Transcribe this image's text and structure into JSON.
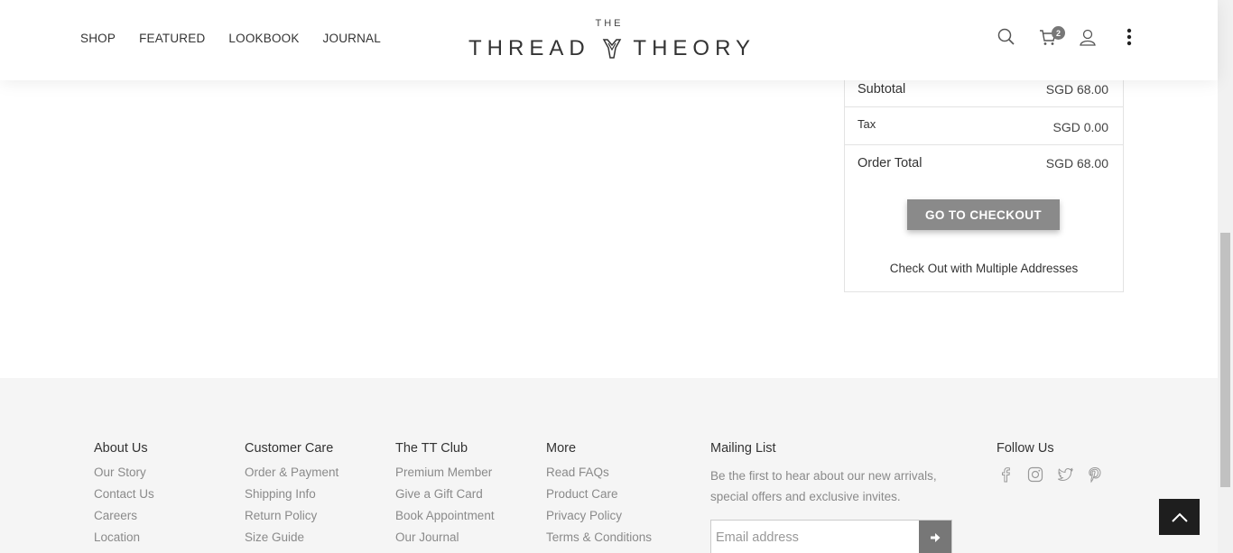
{
  "nav": {
    "items": [
      "SHOP",
      "FEATURED",
      "LOOKBOOK",
      "JOURNAL"
    ]
  },
  "logo": {
    "top": "THE",
    "left": "THREAD",
    "right": "THEORY"
  },
  "header": {
    "cart_count": "2",
    "icons": [
      "search-icon",
      "cart-icon",
      "user-icon",
      "more-vertical-icon"
    ]
  },
  "summary": {
    "subtotal_label": "Subtotal",
    "subtotal_value": "SGD 68.00",
    "tax_label": "Tax",
    "tax_value": "SGD 0.00",
    "total_label": "Order Total",
    "total_value": "SGD 68.00",
    "checkout_label": "GO TO CHECKOUT",
    "multi_label": "Check Out with Multiple Addresses"
  },
  "footer": {
    "about": {
      "title": "About Us",
      "links": [
        "Our Story",
        "Contact Us",
        "Careers",
        "Location"
      ]
    },
    "care": {
      "title": "Customer Care",
      "links": [
        "Order & Payment",
        "Shipping Info",
        "Return Policy",
        "Size Guide"
      ]
    },
    "club": {
      "title": "The TT Club",
      "links": [
        "Premium Member",
        "Give a Gift Card",
        "Book Appointment",
        "Our Journal"
      ]
    },
    "more": {
      "title": "More",
      "links": [
        "Read FAQs",
        "Product Care",
        "Privacy Policy",
        "Terms & Conditions"
      ]
    },
    "mailing": {
      "title": "Mailing List",
      "text": "Be the first to hear about our new arrivals, special offers and exclusive invites.",
      "placeholder": "Email address"
    },
    "follow": {
      "title": "Follow Us",
      "icons": [
        "facebook-icon",
        "instagram-icon",
        "twitter-icon",
        "pinterest-icon"
      ]
    }
  },
  "colors": {
    "button": "#8a8a8a",
    "footer_bg": "#f5f5f5",
    "back_to_top": "#1e1e1e"
  }
}
